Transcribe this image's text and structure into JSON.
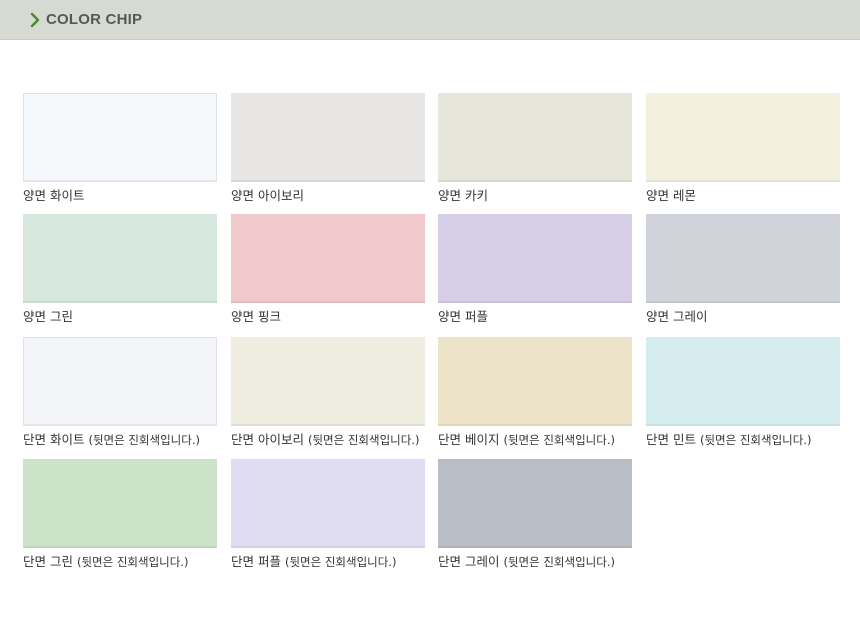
{
  "header": {
    "title": "COLOR CHIP",
    "background": "#d6dad3",
    "chevron_color": "#4c8a2a"
  },
  "chips": [
    {
      "name": "양면 화이트",
      "note": "",
      "color": "#f6f9fc",
      "bordered": true
    },
    {
      "name": "양면 아이보리",
      "note": "",
      "color": "#e8e6e4",
      "bordered": false
    },
    {
      "name": "양면 카키",
      "note": "",
      "color": "#e6e6da",
      "bordered": false
    },
    {
      "name": "양면 레몬",
      "note": "",
      "color": "#f3f0dd",
      "bordered": false
    },
    {
      "name": "양면 그린",
      "note": "",
      "color": "#d6e8de",
      "bordered": false
    },
    {
      "name": "양면 핑크",
      "note": "",
      "color": "#f0c9cc",
      "bordered": false
    },
    {
      "name": "양면 퍼플",
      "note": "",
      "color": "#d7cee7",
      "bordered": false
    },
    {
      "name": "양면 그레이",
      "note": "",
      "color": "#d1d3db",
      "bordered": false
    },
    {
      "name": "단면 화이트",
      "note": "(뒷면은 진회색입니다.)",
      "color": "#f3f5f9",
      "bordered": true
    },
    {
      "name": "단면 아이보리",
      "note": "(뒷면은 진회색입니다.)",
      "color": "#eeede0",
      "bordered": false
    },
    {
      "name": "단면 베이지",
      "note": "(뒷면은 진회색입니다.)",
      "color": "#ede3c9",
      "bordered": false
    },
    {
      "name": "단면 민트",
      "note": "(뒷면은 진회색입니다.)",
      "color": "#d6edf0",
      "bordered": false
    },
    {
      "name": "단면 그린",
      "note": "(뒷면은 진회색입니다.)",
      "color": "#cde3c9",
      "bordered": false
    },
    {
      "name": "단면 퍼플",
      "note": "(뒷면은 진회색입니다.)",
      "color": "#e0dcf1",
      "bordered": false
    },
    {
      "name": "단면 그레이",
      "note": "(뒷면은 진회색입니다.)",
      "color": "#b9bdc5",
      "bordered": false
    }
  ]
}
